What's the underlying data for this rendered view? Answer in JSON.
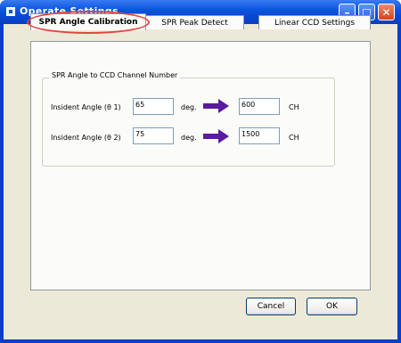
{
  "window": {
    "title": "Operate Settings",
    "minimize_glyph": "–",
    "maximize_glyph": "□",
    "close_glyph": "✕"
  },
  "tabs": [
    {
      "label": "SPR Angle Calibration",
      "active": true
    },
    {
      "label": "SPR Peak Detect",
      "active": false
    },
    {
      "label": "Linear CCD Settings",
      "active": false
    }
  ],
  "group": {
    "title": "SPR Angle to CCD Channel Number",
    "rows": [
      {
        "label": "Insident Angle (θ 1)",
        "angle_value": "65",
        "angle_unit": "deg.",
        "channel_value": "600",
        "channel_unit": "CH"
      },
      {
        "label": "Insident Angle (θ 2)",
        "angle_value": "75",
        "angle_unit": "deg.",
        "channel_value": "1500",
        "channel_unit": "CH"
      }
    ]
  },
  "buttons": {
    "cancel": "Cancel",
    "ok": "OK"
  },
  "colors": {
    "title_bar": "#0b55e0",
    "arrow": "#5a1a9e",
    "highlight_circle": "#e0453a"
  }
}
